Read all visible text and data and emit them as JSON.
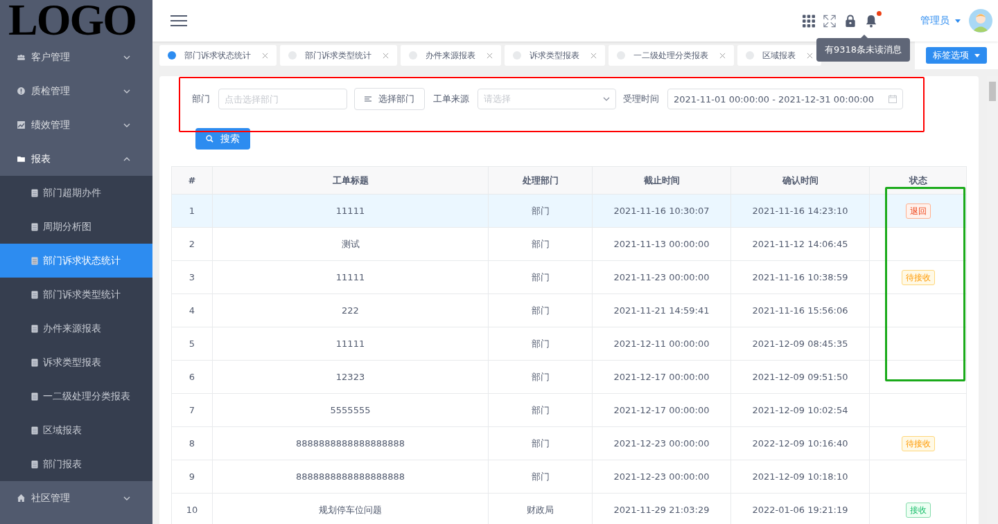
{
  "logo": {
    "text": "LOGO"
  },
  "sidebar": {
    "items": [
      {
        "label": "客户管理",
        "expanded": false
      },
      {
        "label": "质检管理",
        "expanded": false
      },
      {
        "label": "绩效管理",
        "expanded": false
      },
      {
        "label": "报表",
        "expanded": true,
        "children": [
          {
            "label": "部门超期办件",
            "selected": false
          },
          {
            "label": "周期分析图",
            "selected": false
          },
          {
            "label": "部门诉求状态统计",
            "selected": true
          },
          {
            "label": "部门诉求类型统计",
            "selected": false
          },
          {
            "label": "办件来源报表",
            "selected": false
          },
          {
            "label": "诉求类型报表",
            "selected": false
          },
          {
            "label": "一二级处理分类报表",
            "selected": false
          },
          {
            "label": "区域报表",
            "selected": false
          },
          {
            "label": "部门报表",
            "selected": false
          }
        ]
      },
      {
        "label": "社区管理",
        "expanded": false
      }
    ]
  },
  "header": {
    "user": "管理员",
    "notification_tooltip": "有9318条未读消息"
  },
  "tabs": [
    {
      "label": "部门诉求状态统计",
      "selected": true
    },
    {
      "label": "部门诉求类型统计",
      "selected": false
    },
    {
      "label": "办件来源报表",
      "selected": false
    },
    {
      "label": "诉求类型报表",
      "selected": false
    },
    {
      "label": "一二级处理分类报表",
      "selected": false
    },
    {
      "label": "区域报表",
      "selected": false
    }
  ],
  "tab_options_button": "标签选项",
  "filters": {
    "dept_label": "部门",
    "dept_placeholder": "点击选择部门",
    "choose_dept_button": "选择部门",
    "source_label": "工单来源",
    "source_placeholder": "请选择",
    "time_label": "受理时间",
    "time_value": "2021-11-01 00:00:00 - 2021-12-31 00:00:00",
    "search_button": "搜索"
  },
  "table": {
    "columns": [
      "#",
      "工单标题",
      "处理部门",
      "截止时间",
      "确认时间",
      "状态"
    ],
    "rows": [
      {
        "cells": [
          "1",
          "11111",
          "部门",
          "2021-11-16 10:30:07",
          "2021-11-16 14:23:10"
        ],
        "status": {
          "text": "退回",
          "kind": "returned"
        },
        "selected": true
      },
      {
        "cells": [
          "2",
          "测试",
          "部门",
          "2021-11-13 00:00:00",
          "2021-11-12 14:06:45"
        ],
        "selected": false
      },
      {
        "cells": [
          "3",
          "11111",
          "部门",
          "2021-11-23 00:00:00",
          "2021-11-16 10:38:59"
        ],
        "status": {
          "text": "待接收",
          "kind": "pending"
        },
        "selected": false
      },
      {
        "cells": [
          "4",
          "222",
          "部门",
          "2021-11-21 14:59:41",
          "2021-11-16 15:56:06"
        ],
        "selected": false
      },
      {
        "cells": [
          "5",
          "11111",
          "部门",
          "2021-12-11 00:00:00",
          "2021-12-09 08:45:35"
        ],
        "selected": false
      },
      {
        "cells": [
          "6",
          "12323",
          "部门",
          "2021-12-17 00:00:00",
          "2021-12-09 09:51:50"
        ],
        "selected": false
      },
      {
        "cells": [
          "7",
          "5555555",
          "部门",
          "2021-12-17 00:00:00",
          "2021-12-09 10:02:54"
        ],
        "selected": false
      },
      {
        "cells": [
          "8",
          "8888888888888888888",
          "部门",
          "2021-12-23 00:00:00",
          "2022-12-09 10:16:40"
        ],
        "status": {
          "text": "待接收",
          "kind": "pending"
        },
        "selected": false
      },
      {
        "cells": [
          "9",
          "8888888888888888888",
          "部门",
          "2021-12-23 00:00:00",
          "2021-12-09 10:18:10"
        ],
        "selected": false
      },
      {
        "cells": [
          "10",
          "规划停车位问题",
          "财政局",
          "2021-11-29 21:03:29",
          "2022-01-06 19:21:19"
        ],
        "status": {
          "text": "接收",
          "kind": "accepted"
        },
        "selected": false
      }
    ]
  },
  "annotations": [
    {
      "color": "#ff0000"
    },
    {
      "color": "#1aaa1a"
    }
  ]
}
